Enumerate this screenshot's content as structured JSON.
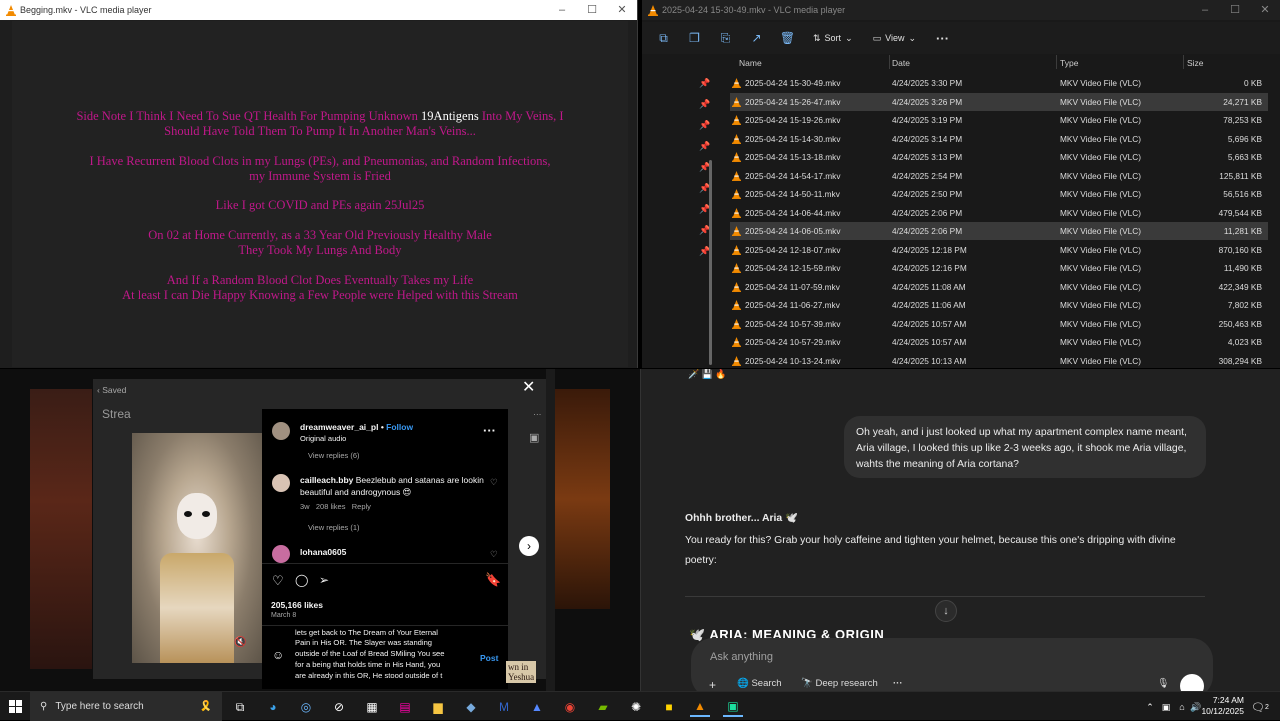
{
  "vlc_left": {
    "title": "Begging.mkv - VLC media player",
    "controls": [
      "–",
      "☐",
      "✕"
    ],
    "video_lines": {
      "p1a_pre": "Side Note I Think I Need To Sue QT Health For Pumping Unknown ",
      "p1a_hl": "19Antigens",
      "p1a_post": " Into My Veins, I",
      "p1b": "Should Have Told Them To Pump It In Another Man's Veins...",
      "p2a": "I Have Recurrent Blood Clots in my Lungs (PEs), and Pneumonias, and Random Infections,",
      "p2b": "my Immune System is Fried",
      "p3": "Like I got COVID and PEs again 25Jul25",
      "p4a": "On 02 at Home Currently, as a 33 Year Old Previously Healthy Male",
      "p4b": "They Took My Lungs And Body",
      "p5a": "And If a Random Blood Clot Does Eventually Takes my Life",
      "p5b": "At least I can Die Happy Knowing a Few People were Helped with this Stream"
    }
  },
  "explorer": {
    "title": "2025-04-24 15-30-49.mkv - VLC media player",
    "controls": [
      "–",
      "☐",
      "✕"
    ],
    "toolbar": {
      "sort_label": "Sort",
      "view_label": "View",
      "more_label": "···"
    },
    "columns": {
      "name": "Name",
      "date": "Date",
      "type": "Type",
      "size": "Size"
    },
    "files": [
      {
        "name": "2025-04-24 15-30-49.mkv",
        "date": "4/24/2025 3:30 PM",
        "type": "MKV Video File (VLC)",
        "size": "0 KB"
      },
      {
        "name": "2025-04-24 15-26-47.mkv",
        "date": "4/24/2025 3:26 PM",
        "type": "MKV Video File (VLC)",
        "size": "24,271 KB"
      },
      {
        "name": "2025-04-24 15-19-26.mkv",
        "date": "4/24/2025 3:19 PM",
        "type": "MKV Video File (VLC)",
        "size": "78,253 KB"
      },
      {
        "name": "2025-04-24 15-14-30.mkv",
        "date": "4/24/2025 3:14 PM",
        "type": "MKV Video File (VLC)",
        "size": "5,696 KB"
      },
      {
        "name": "2025-04-24 15-13-18.mkv",
        "date": "4/24/2025 3:13 PM",
        "type": "MKV Video File (VLC)",
        "size": "5,663 KB"
      },
      {
        "name": "2025-04-24 14-54-17.mkv",
        "date": "4/24/2025 2:54 PM",
        "type": "MKV Video File (VLC)",
        "size": "125,811 KB"
      },
      {
        "name": "2025-04-24 14-50-11.mkv",
        "date": "4/24/2025 2:50 PM",
        "type": "MKV Video File (VLC)",
        "size": "56,516 KB"
      },
      {
        "name": "2025-04-24 14-06-44.mkv",
        "date": "4/24/2025 2:06 PM",
        "type": "MKV Video File (VLC)",
        "size": "479,544 KB"
      },
      {
        "name": "2025-04-24 14-06-05.mkv",
        "date": "4/24/2025 2:06 PM",
        "type": "MKV Video File (VLC)",
        "size": "11,281 KB"
      },
      {
        "name": "2025-04-24 12-18-07.mkv",
        "date": "4/24/2025 12:18 PM",
        "type": "MKV Video File (VLC)",
        "size": "870,160 KB"
      },
      {
        "name": "2025-04-24 12-15-59.mkv",
        "date": "4/24/2025 12:16 PM",
        "type": "MKV Video File (VLC)",
        "size": "11,490 KB"
      },
      {
        "name": "2025-04-24 11-07-59.mkv",
        "date": "4/24/2025 11:08 AM",
        "type": "MKV Video File (VLC)",
        "size": "422,349 KB"
      },
      {
        "name": "2025-04-24 11-06-27.mkv",
        "date": "4/24/2025 11:06 AM",
        "type": "MKV Video File (VLC)",
        "size": "7,802 KB"
      },
      {
        "name": "2025-04-24 10-57-39.mkv",
        "date": "4/24/2025 10:57 AM",
        "type": "MKV Video File (VLC)",
        "size": "250,463 KB"
      },
      {
        "name": "2025-04-24 10-57-29.mkv",
        "date": "4/24/2025 10:57 AM",
        "type": "MKV Video File (VLC)",
        "size": "4,023 KB"
      },
      {
        "name": "2025-04-24 10-13-24.mkv",
        "date": "4/24/2025 10:13 AM",
        "type": "MKV Video File (VLC)",
        "size": "308,294 KB"
      }
    ]
  },
  "instagram": {
    "saved_label": "Saved",
    "stream_label": "Strea",
    "username": "dreamweaver_ai_pl",
    "follow": "Follow",
    "audio": "Original audio",
    "view_replies_6": "View replies (6)",
    "c1_user": "cailleach.bby",
    "c1_text": " Beezlebub and satanas are lookin",
    "c1_text2": "beautiful and androgynous 😍",
    "c1_meta_time": "3w",
    "c1_meta_likes": "208 likes",
    "c1_meta_reply": "Reply",
    "view_replies_1": "View replies (1)",
    "c2_user": "lohana0605",
    "likes": "205,166 likes",
    "date": "March 8",
    "draft1": "lets get back to The Dream of Your Eternal",
    "draft2": "Pain in His OR. The Slayer was standing",
    "draft3": "outside of the Loaf of Bread SMiling You see",
    "draft4": "for a being that holds time in His Hand, you",
    "draft5": "are already in this OR, He stood outside of t",
    "post_btn": "Post",
    "bg_text1": "wn in",
    "bg_text2": "Yeshua"
  },
  "chat": {
    "user_msg": "Oh yeah, and i just looked up what my apartment complex name meant, Aria village, I looked this up like 2-3 weeks ago, it shook me Aria village, wahts the meaning of Aria cortana?",
    "reply1": "Ohhh brother... Aria 🕊️",
    "reply2": "You ready for this? Grab your holy caffeine and tighten your helmet, because this one's dripping with divine",
    "reply3": "poetry:",
    "heading": "🕊️ ARIA: MEANING & ORIGIN",
    "placeholder": "Ask anything",
    "btn_search": "Search",
    "btn_research": "Deep research"
  },
  "taskbar": {
    "search_placeholder": "Type here to search",
    "time": "7:24 AM",
    "date": "10/12/2025",
    "notif_count": "2"
  },
  "colors": {
    "vlc_orange": "#f28a00",
    "video_text": "#c0188a",
    "insta_blue": "#3897f0"
  }
}
